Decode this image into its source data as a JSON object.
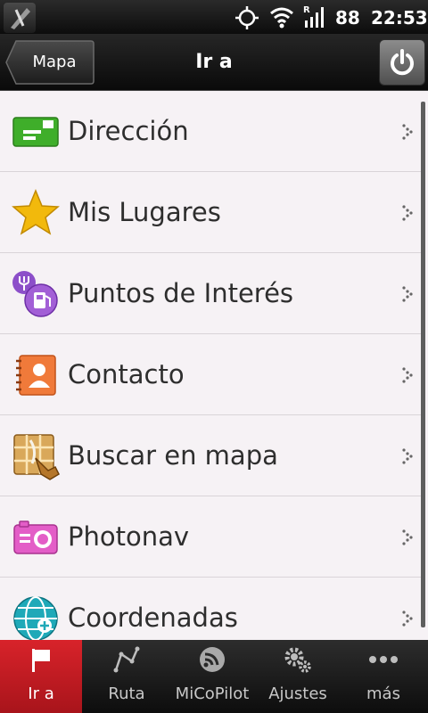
{
  "status_bar": {
    "battery": "88",
    "time": "22:53",
    "icons": [
      "app-icon",
      "gps-icon",
      "wifi-icon",
      "signal-icon"
    ]
  },
  "header": {
    "back_label": "Mapa",
    "title": "Ir a",
    "power_icon": "power-icon"
  },
  "menu": {
    "items": [
      {
        "label": "Dirección",
        "icon": "address-card-icon",
        "color": "#3fae2a"
      },
      {
        "label": "Mis Lugares",
        "icon": "star-icon",
        "color": "#f2b90c"
      },
      {
        "label": "Puntos de Interés",
        "icon": "poi-icon",
        "color": "#8c4fc9"
      },
      {
        "label": "Contacto",
        "icon": "contact-icon",
        "color": "#f07a3a"
      },
      {
        "label": "Buscar en mapa",
        "icon": "map-search-icon",
        "color": "#c48a2e"
      },
      {
        "label": "Photonav",
        "icon": "camera-icon",
        "color": "#e35dc7"
      },
      {
        "label": "Coordenadas",
        "icon": "globe-icon",
        "color": "#1fa9b8"
      }
    ]
  },
  "bottom_nav": {
    "items": [
      {
        "label": "Ir a",
        "icon": "flag-icon",
        "active": true
      },
      {
        "label": "Ruta",
        "icon": "route-icon",
        "active": false
      },
      {
        "label": "MiCoPilot",
        "icon": "copilot-icon",
        "active": false
      },
      {
        "label": "Ajustes",
        "icon": "gears-icon",
        "active": false
      },
      {
        "label": "más",
        "icon": "more-icon",
        "active": false
      }
    ]
  },
  "colors": {
    "accent": "#c81b22",
    "list_background": "#f6f2f5"
  }
}
